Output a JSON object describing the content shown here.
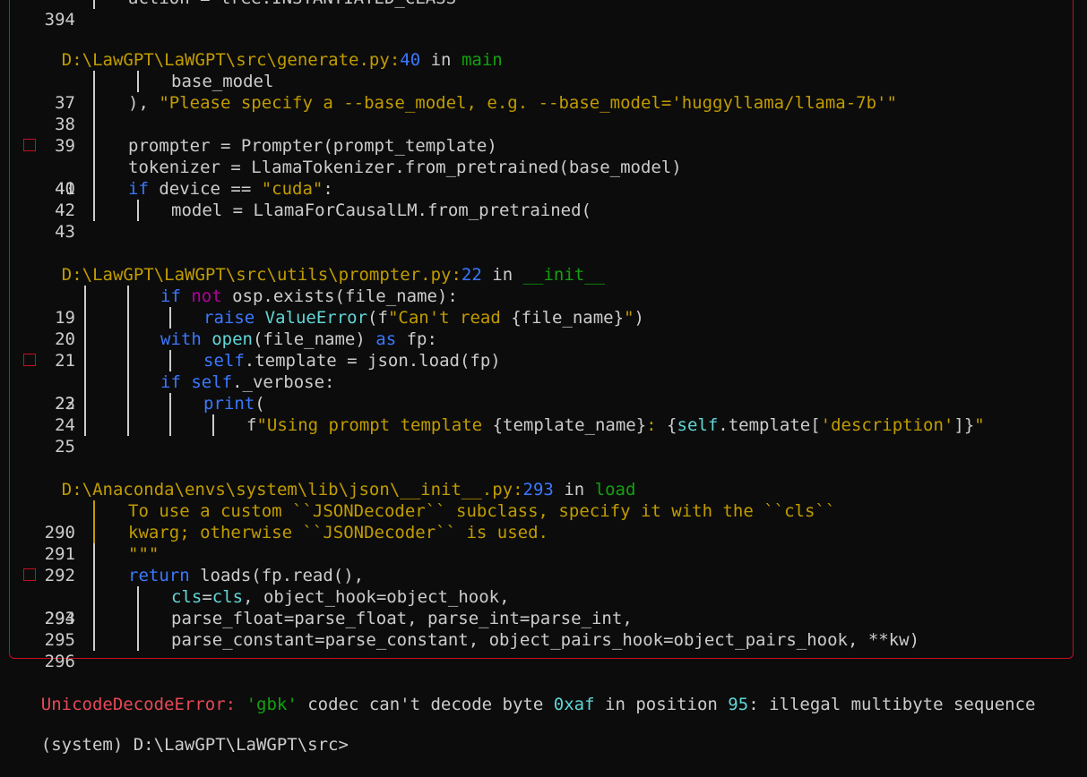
{
  "top_partial": "394 │   action = tree.INSTANTIATED_CLASS",
  "frames": [
    {
      "file": "D:\\LawGPT\\LaWGPT\\src\\generate.py",
      "line": "40",
      "in_word": "in",
      "func": "main",
      "lines": [
        {
          "n": "37",
          "code": "│   base_model"
        },
        {
          "n": "38",
          "code": "), \"Please specify a --base_model, e.g. --base_model='huggyllama/llama-7b'\""
        },
        {
          "n": "39",
          "code": ""
        },
        {
          "n": "40",
          "code": "prompter = Prompter(prompt_template)"
        },
        {
          "n": "41",
          "code": "tokenizer = LlamaTokenizer.from_pretrained(base_model)"
        },
        {
          "n": "42",
          "code": "if device == \"cuda\":"
        },
        {
          "n": "43",
          "code": "│   model = LlamaForCausalLM.from_pretrained("
        }
      ]
    },
    {
      "file": "D:\\LawGPT\\LaWGPT\\src\\utils\\prompter.py",
      "line": "22",
      "in_word": "in",
      "func": "__init__",
      "lines": [
        {
          "n": "19",
          "code": "if not osp.exists(file_name):"
        },
        {
          "n": "20",
          "code": "│   raise ValueError(f\"Can't read {file_name}\")"
        },
        {
          "n": "21",
          "code": "with open(file_name) as fp:"
        },
        {
          "n": "22",
          "code": "│   self.template = json.load(fp)"
        },
        {
          "n": "23",
          "code": "if self._verbose:"
        },
        {
          "n": "24",
          "code": "│   print("
        },
        {
          "n": "25",
          "code": "│   │   f\"Using prompt template {template_name}: {self.template['description']}\""
        }
      ]
    },
    {
      "file": "D:\\Anaconda\\envs\\system\\lib\\json\\__init__.py",
      "line": "293",
      "in_word": "in",
      "func": "load",
      "lines": [
        {
          "n": "290",
          "code": "To use a custom ``JSONDecoder`` subclass, specify it with the ``cls``"
        },
        {
          "n": "291",
          "code": "kwarg; otherwise ``JSONDecoder`` is used."
        },
        {
          "n": "292",
          "code": "\"\"\""
        },
        {
          "n": "293",
          "code": "return loads(fp.read(),"
        },
        {
          "n": "294",
          "code": "│   cls=cls, object_hook=object_hook,"
        },
        {
          "n": "295",
          "code": "│   parse_float=parse_float, parse_int=parse_int,"
        },
        {
          "n": "296",
          "code": "│   parse_constant=parse_constant, object_pairs_hook=object_pairs_hook, **kw)"
        }
      ]
    }
  ],
  "error": {
    "type": "UnicodeDecodeError:",
    "codec": "'gbk'",
    "msg1": "codec can't decode byte",
    "byte": "0xaf",
    "msg2": "in position",
    "pos": "95",
    "msg3": ": illegal multibyte sequence"
  },
  "prompt_partial": "(system) D:\\LawGPT\\LaWGPT\\src>",
  "colors": {
    "background": "#0c0c0c",
    "text": "#cccccc",
    "path": "#c19c00",
    "keyword": "#3b78ff",
    "function": "#13a10e",
    "error": "#e74856",
    "border": "#c50f1f"
  }
}
